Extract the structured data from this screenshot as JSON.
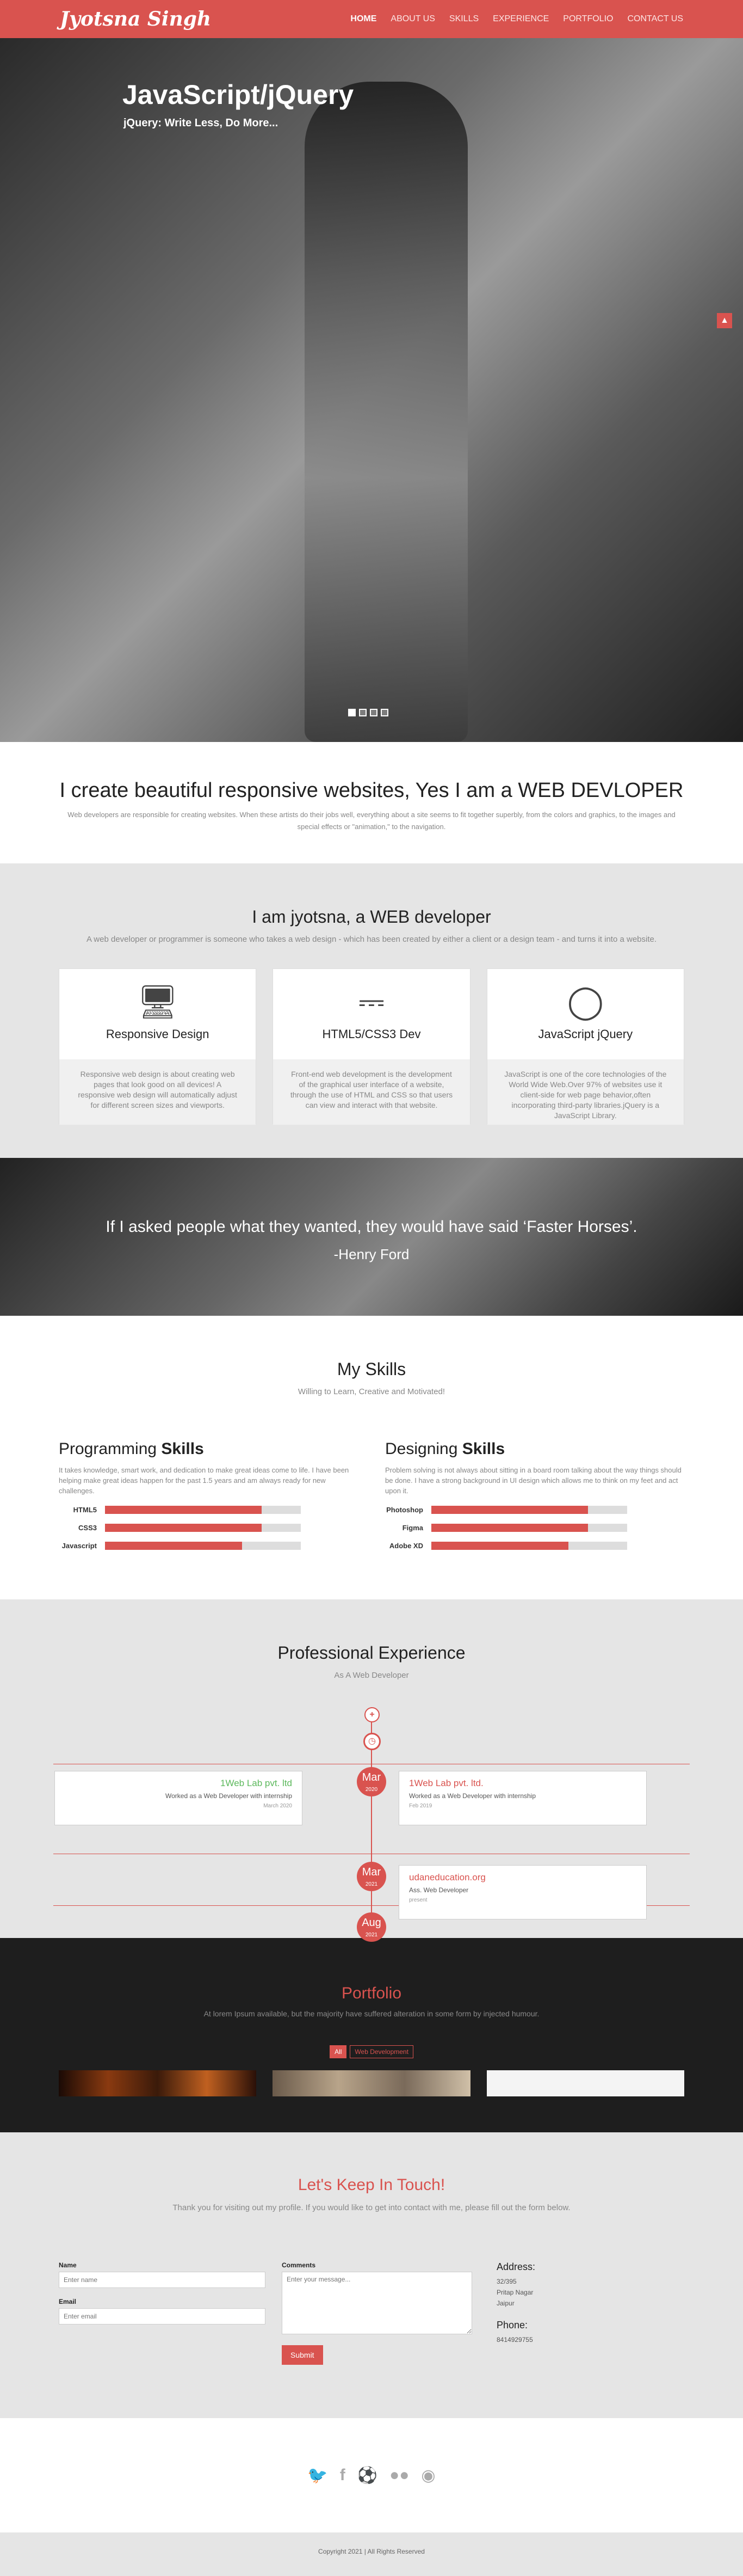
{
  "nav": {
    "brand": "Jyotsna Singh",
    "links": [
      "HOME",
      "ABOUT US",
      "SKILLS",
      "EXPERIENCE",
      "PORTFOLIO",
      "CONTACT US"
    ]
  },
  "hero": {
    "title": "JavaScript/jQuery",
    "subtitle": "jQuery: Write Less, Do More...",
    "scroll_top_icon": "chevron-up-icon"
  },
  "intro": {
    "title": "I create beautiful responsive websites, Yes I am a WEB DEVLOPER",
    "text": "Web developers are responsible for creating websites. When these artists do their jobs well, everything about a site seems to fit together superbly, from the colors and graphics, to the images and special effects or \"animation,\" to the navigation."
  },
  "about": {
    "title": "I am jyotsna, a WEB developer",
    "subtitle": "A web developer or programmer is someone who takes a web design - which has been created by either a client or a design team - and turns it into a website.",
    "cards": [
      {
        "icon": "monitor-icon",
        "title": "Responsive Design",
        "text": "Responsive web design is about creating web pages that look good on all devices! A responsive web design will automatically adjust for different screen sizes and viewports."
      },
      {
        "icon": "css3-icon",
        "title": "HTML5/CSS3 Dev",
        "text": "Front-end web development is the development of the graphical user interface of a website, through the use of HTML and CSS so that users can view and interact with that website."
      },
      {
        "icon": "lightbulb-icon",
        "title": "JavaScript jQuery",
        "text": "JavaScript is one of the core technologies of the World Wide Web.Over 97% of websites use it client-side for web page behavior,often incorporating third-party libraries.jQuery is a JavaScript Library."
      }
    ]
  },
  "quote": {
    "text": "If I asked people what they wanted, they would have said ‘Faster Horses’.",
    "author": "-Henry Ford"
  },
  "skills": {
    "title": "My Skills",
    "subtitle": "Willing to Learn, Creative and Motivated!",
    "programming": {
      "heading_a": "Programming ",
      "heading_b": "Skills",
      "desc": "It takes knowledge, smart work, and dedication to make great ideas come to life. I have been helping make great ideas happen for the past 1.5 years and am always ready for new challenges.",
      "items": [
        {
          "name": "HTML5",
          "level": 0.8
        },
        {
          "name": "CSS3",
          "level": 0.8
        },
        {
          "name": "Javascript",
          "level": 0.7
        }
      ]
    },
    "designing": {
      "heading_a": "Designing ",
      "heading_b": "Skills",
      "desc": "Problem solving is not always about sitting in a board room talking about the way things should be done. I have a strong background in UI design which allows me to think on my feet and act upon it.",
      "items": [
        {
          "name": "Photoshop",
          "level": 0.8
        },
        {
          "name": "Figma",
          "level": 0.8
        },
        {
          "name": "Adobe XD",
          "level": 0.7
        }
      ]
    }
  },
  "experience": {
    "title": "Professional Experience",
    "subtitle": "As A Web Developer",
    "entries": [
      {
        "company": "1Web Lab pvt. ltd",
        "role": "Worked as a Web Developer with internship",
        "date": "March 2020",
        "month": "Mar",
        "year": "2020"
      },
      {
        "company": "1Web Lab pvt. ltd.",
        "role": "Worked as a Web Developer with internship",
        "date": "Feb 2019",
        "month": "Feb",
        "year": "2019"
      },
      {
        "company": "udaneducation.org",
        "role": "Ass. Web Developer",
        "date": "present",
        "month": "Mar",
        "year": "2021"
      }
    ],
    "last_month": "Aug",
    "last_year": "2021"
  },
  "portfolio": {
    "title": "Portfolio",
    "subtitle": "At lorem Ipsum available, but the majority have suffered alteration in some form by injected humour.",
    "filters": [
      "All",
      "Web Development"
    ]
  },
  "contact": {
    "title": "Let's Keep In Touch!",
    "subtitle": "Thank you for visiting out my profile. If you would like to get into contact with me, please fill out the form below.",
    "name_label": "Name",
    "name_placeholder": "Enter name",
    "email_label": "Email",
    "email_placeholder": "Enter email",
    "comments_label": "Comments",
    "comments_placeholder": "Enter your message...",
    "submit_label": "Submit",
    "address_heading": "Address:",
    "address_lines": [
      "32/395",
      "Pritap Nagar",
      "Jaipur"
    ],
    "phone_heading": "Phone:",
    "phone": "8414929755"
  },
  "social_icons": [
    "twitter-icon",
    "facebook-icon",
    "dribbble-icon",
    "flickr-icon",
    "github-icon"
  ],
  "footer": {
    "text": "Copyright 2021 | All Rights Reserved"
  },
  "colors": {
    "accent": "#d9534f",
    "dark": "#1e1e1e",
    "light_bg": "#e5e5e5"
  }
}
